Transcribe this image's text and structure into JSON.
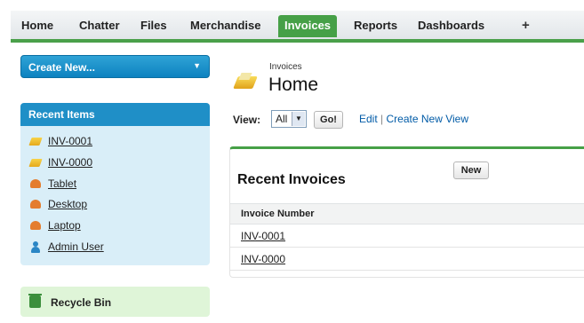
{
  "tabs": [
    {
      "label": "Home"
    },
    {
      "label": "Chatter"
    },
    {
      "label": "Files"
    },
    {
      "label": "Merchandise"
    },
    {
      "label": "Invoices",
      "active": true
    },
    {
      "label": "Reports"
    },
    {
      "label": "Dashboards"
    }
  ],
  "tab_plus": "+",
  "sidebar": {
    "create_new": "Create New...",
    "recent_items_title": "Recent Items",
    "recent_items": [
      {
        "label": "INV-0001",
        "icon": "invoice-icon"
      },
      {
        "label": "INV-0000",
        "icon": "invoice-icon"
      },
      {
        "label": "Tablet",
        "icon": "merchandise-icon"
      },
      {
        "label": "Desktop",
        "icon": "merchandise-icon"
      },
      {
        "label": "Laptop",
        "icon": "merchandise-icon"
      },
      {
        "label": "Admin User",
        "icon": "user-icon"
      }
    ],
    "recycle_bin": "Recycle Bin"
  },
  "header": {
    "subtitle": "Invoices",
    "title": "Home"
  },
  "view": {
    "label": "View:",
    "selected": "All",
    "go": "Go!",
    "edit": "Edit",
    "separator": "|",
    "create_view": "Create New View"
  },
  "recent_list": {
    "title": "Recent Invoices",
    "new_button": "New",
    "column": "Invoice Number",
    "rows": [
      "INV-0001",
      "INV-0000"
    ]
  },
  "colors": {
    "accent_green": "#46a047",
    "accent_blue": "#1f8fc7",
    "link": "#015ba7"
  }
}
